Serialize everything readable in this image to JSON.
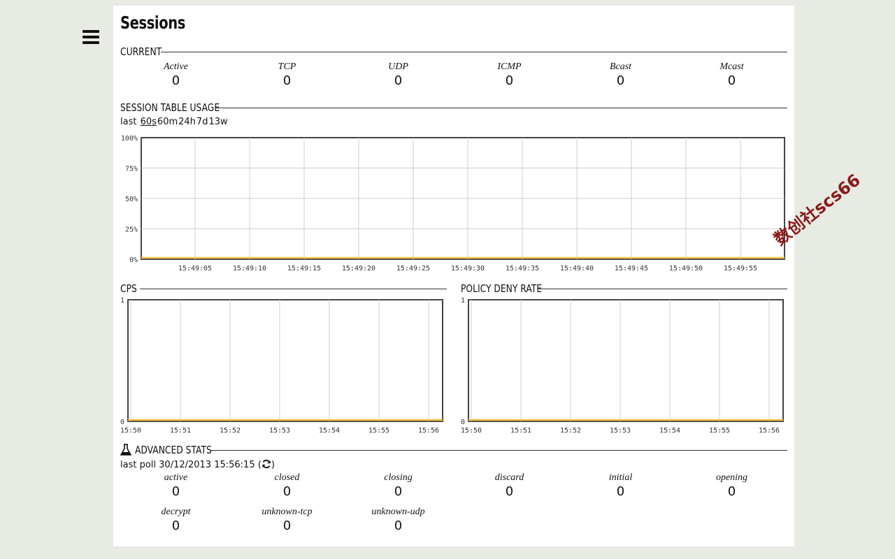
{
  "page": {
    "title": "Sessions"
  },
  "sections": {
    "current": "CURRENT",
    "session_table": "SESSION TABLE USAGE",
    "cps": "CPS",
    "policy_deny": "POLICY DENY RATE",
    "advanced": "ADVANCED STATS"
  },
  "current": [
    {
      "label": "Active",
      "value": "0"
    },
    {
      "label": "TCP",
      "value": "0"
    },
    {
      "label": "UDP",
      "value": "0"
    },
    {
      "label": "ICMP",
      "value": "0"
    },
    {
      "label": "Bcast",
      "value": "0"
    },
    {
      "label": "Mcast",
      "value": "0"
    }
  ],
  "range": {
    "prefix": "last",
    "options": [
      "60s",
      "60m",
      "24h",
      "7d",
      "13w"
    ],
    "selected": "60s"
  },
  "advanced": {
    "poll_prefix": "last poll",
    "poll_time": "30/12/2013 15:56:15",
    "row1": [
      {
        "label": "active",
        "value": "0"
      },
      {
        "label": "closed",
        "value": "0"
      },
      {
        "label": "closing",
        "value": "0"
      },
      {
        "label": "discard",
        "value": "0"
      },
      {
        "label": "initial",
        "value": "0"
      },
      {
        "label": "opening",
        "value": "0"
      }
    ],
    "row2": [
      {
        "label": "decrypt",
        "value": "0"
      },
      {
        "label": "unknown-tcp",
        "value": "0"
      },
      {
        "label": "unknown-udp",
        "value": "0"
      }
    ]
  },
  "watermark": "数创社scs66",
  "colors": {
    "series": "#f0c040",
    "grid": "#cfcfcf",
    "frame": "#444444"
  },
  "icons": {
    "menu": "hamburger-icon",
    "advanced": "flask-icon",
    "refresh": "refresh-icon"
  },
  "chart_data": [
    {
      "type": "line",
      "name": "session-table-usage",
      "x": [
        "15:49:05",
        "15:49:10",
        "15:49:15",
        "15:49:20",
        "15:49:25",
        "15:49:30",
        "15:49:35",
        "15:49:40",
        "15:49:45",
        "15:49:50",
        "15:49:55"
      ],
      "yticks": [
        "0%",
        "25%",
        "50%",
        "75%",
        "100%"
      ],
      "ylim": [
        0,
        100
      ],
      "series": [
        {
          "values": [
            0,
            0,
            0,
            0,
            0,
            0,
            0,
            0,
            0,
            0,
            0
          ]
        }
      ],
      "grid": true
    },
    {
      "type": "line",
      "name": "cps",
      "x": [
        "15:50",
        "15:51",
        "15:52",
        "15:53",
        "15:54",
        "15:55",
        "15:56"
      ],
      "yticks": [
        "0",
        "1"
      ],
      "ylim": [
        0,
        1
      ],
      "series": [
        {
          "values": [
            0,
            0,
            0,
            0,
            0,
            0,
            0
          ]
        }
      ],
      "grid": true
    },
    {
      "type": "line",
      "name": "policy-deny-rate",
      "x": [
        "15:50",
        "15:51",
        "15:52",
        "15:53",
        "15:54",
        "15:55",
        "15:56"
      ],
      "yticks": [
        "0",
        "1"
      ],
      "ylim": [
        0,
        1
      ],
      "series": [
        {
          "values": [
            0,
            0,
            0,
            0,
            0,
            0,
            0
          ]
        }
      ],
      "grid": true
    }
  ]
}
